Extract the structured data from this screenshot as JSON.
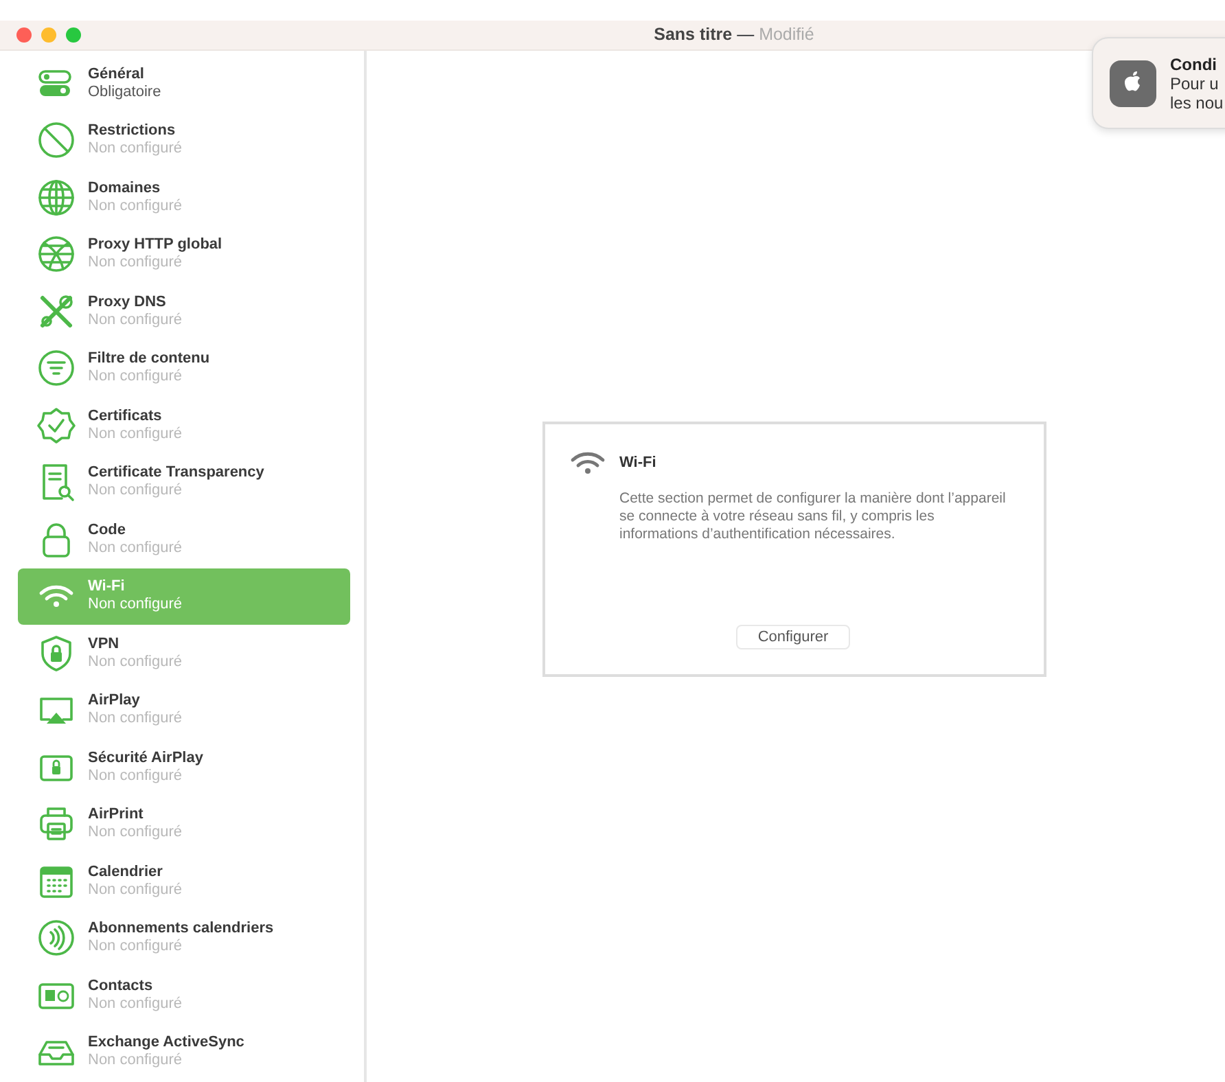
{
  "window": {
    "title": "Sans titre",
    "separator": "—",
    "state": "Modifié"
  },
  "sidebar": {
    "items": [
      {
        "label": "Général",
        "status": "Obligatoire",
        "selected": false,
        "configured": true
      },
      {
        "label": "Restrictions",
        "status": "Non configuré",
        "selected": false,
        "configured": false
      },
      {
        "label": "Domaines",
        "status": "Non configuré",
        "selected": false,
        "configured": false
      },
      {
        "label": "Proxy HTTP global",
        "status": "Non configuré",
        "selected": false,
        "configured": false
      },
      {
        "label": "Proxy DNS",
        "status": "Non configuré",
        "selected": false,
        "configured": false
      },
      {
        "label": "Filtre de contenu",
        "status": "Non configuré",
        "selected": false,
        "configured": false
      },
      {
        "label": "Certificats",
        "status": "Non configuré",
        "selected": false,
        "configured": false
      },
      {
        "label": "Certificate Transparency",
        "status": "Non configuré",
        "selected": false,
        "configured": false
      },
      {
        "label": "Code",
        "status": "Non configuré",
        "selected": false,
        "configured": false
      },
      {
        "label": "Wi-Fi",
        "status": "Non configuré",
        "selected": true,
        "configured": false
      },
      {
        "label": "VPN",
        "status": "Non configuré",
        "selected": false,
        "configured": false
      },
      {
        "label": "AirPlay",
        "status": "Non configuré",
        "selected": false,
        "configured": false
      },
      {
        "label": "Sécurité AirPlay",
        "status": "Non configuré",
        "selected": false,
        "configured": false
      },
      {
        "label": "AirPrint",
        "status": "Non configuré",
        "selected": false,
        "configured": false
      },
      {
        "label": "Calendrier",
        "status": "Non configuré",
        "selected": false,
        "configured": false
      },
      {
        "label": "Abonnements calendriers",
        "status": "Non configuré",
        "selected": false,
        "configured": false
      },
      {
        "label": "Contacts",
        "status": "Non configuré",
        "selected": false,
        "configured": false
      },
      {
        "label": "Exchange ActiveSync",
        "status": "Non configuré",
        "selected": false,
        "configured": false
      }
    ]
  },
  "panel": {
    "title": "Wi-Fi",
    "description": "Cette section permet de configurer la manière dont l’appareil se connecte à votre réseau sans fil, y compris les informations d’authentification nécessaires.",
    "button": "Configurer"
  },
  "notification": {
    "title": "Condi",
    "lines": [
      "Pour u",
      "les nou"
    ]
  }
}
